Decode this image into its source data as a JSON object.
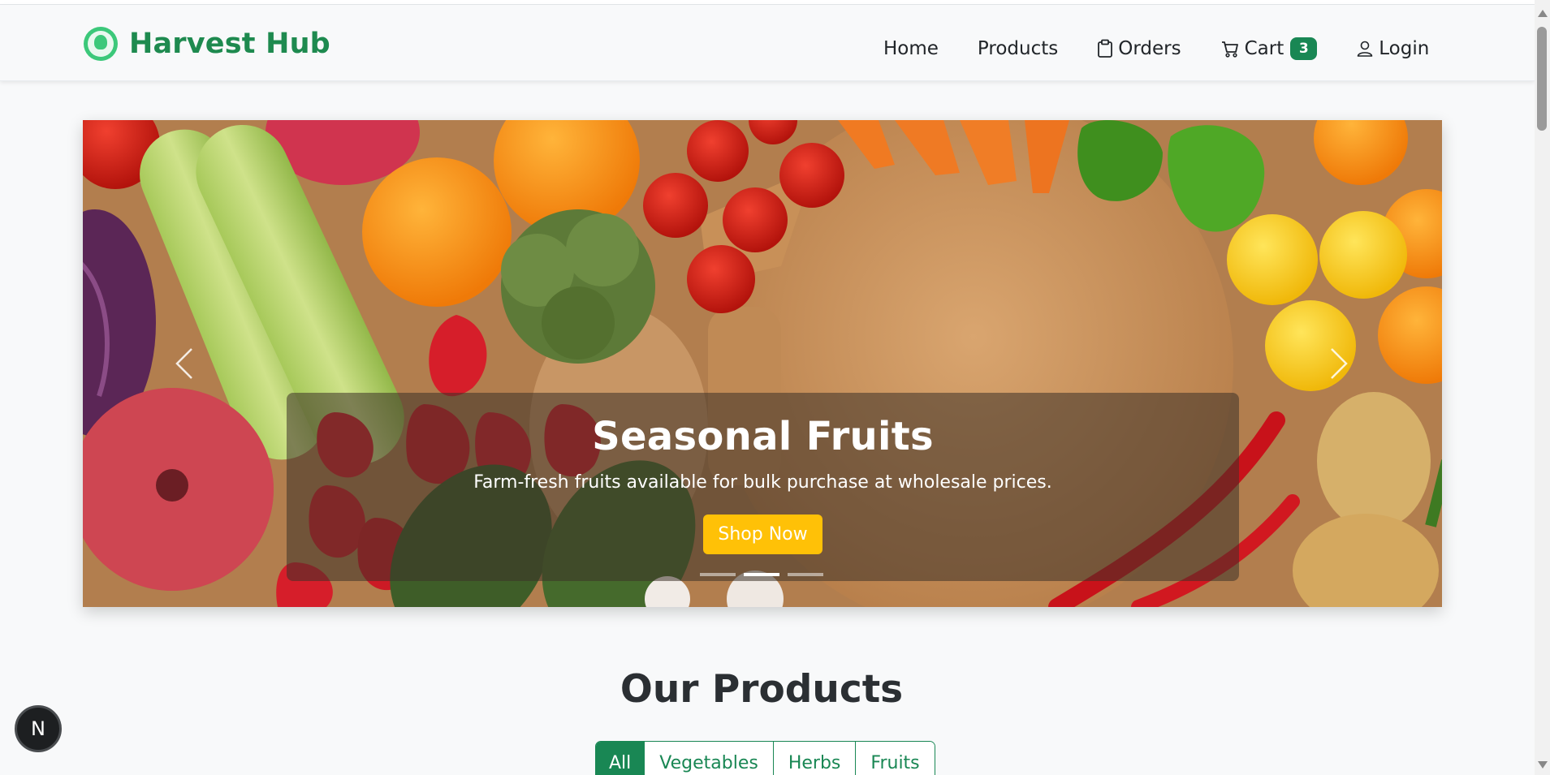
{
  "brand": {
    "name": "Harvest Hub",
    "color": "#1e8a4f",
    "logo_icon": "leaf-logo-icon"
  },
  "nav": {
    "home": "Home",
    "products": "Products",
    "orders": "Orders",
    "cart": "Cart",
    "cart_count": "3",
    "login": "Login"
  },
  "hero": {
    "title": "Seasonal Fruits",
    "subtitle": "Farm-fresh fruits available for bulk purchase at wholesale prices.",
    "cta": "Shop Now",
    "slide_count": 3,
    "active_slide": 2,
    "cta_color": "#ffc107"
  },
  "products": {
    "title": "Our Products",
    "filters": [
      "All",
      "Vegetables",
      "Herbs",
      "Fruits"
    ],
    "active_filter": "All",
    "accent": "#198754"
  },
  "floating_button": {
    "label": "N"
  }
}
